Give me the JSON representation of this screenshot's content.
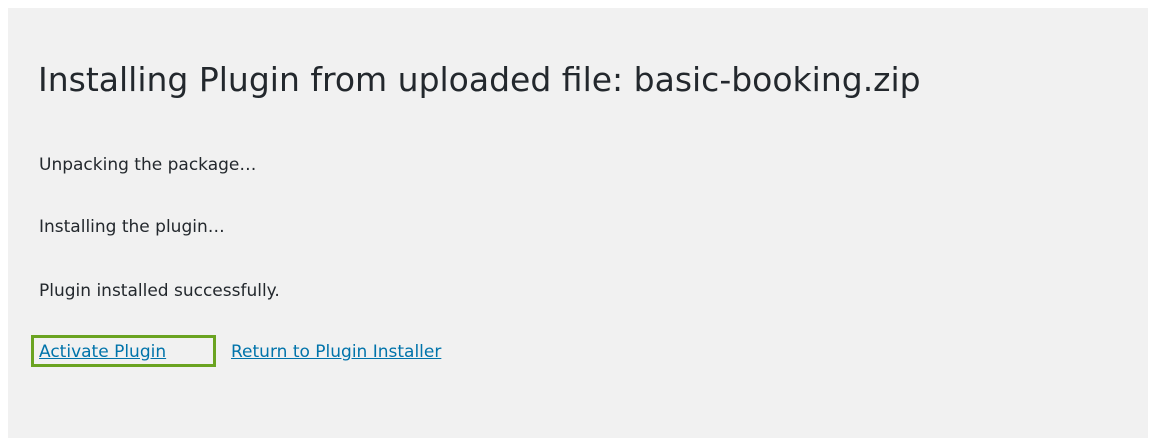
{
  "page": {
    "title": "Installing Plugin from uploaded file: basic-booking.zip"
  },
  "log": [
    "Unpacking the package…",
    "Installing the plugin…",
    "Plugin installed successfully."
  ],
  "actions": {
    "activate_label": "Activate Plugin",
    "return_label": "Return to Plugin Installer"
  },
  "colors": {
    "background": "#f1f1f1",
    "text": "#23282d",
    "link": "#0073aa",
    "highlight": "#6aa321"
  }
}
